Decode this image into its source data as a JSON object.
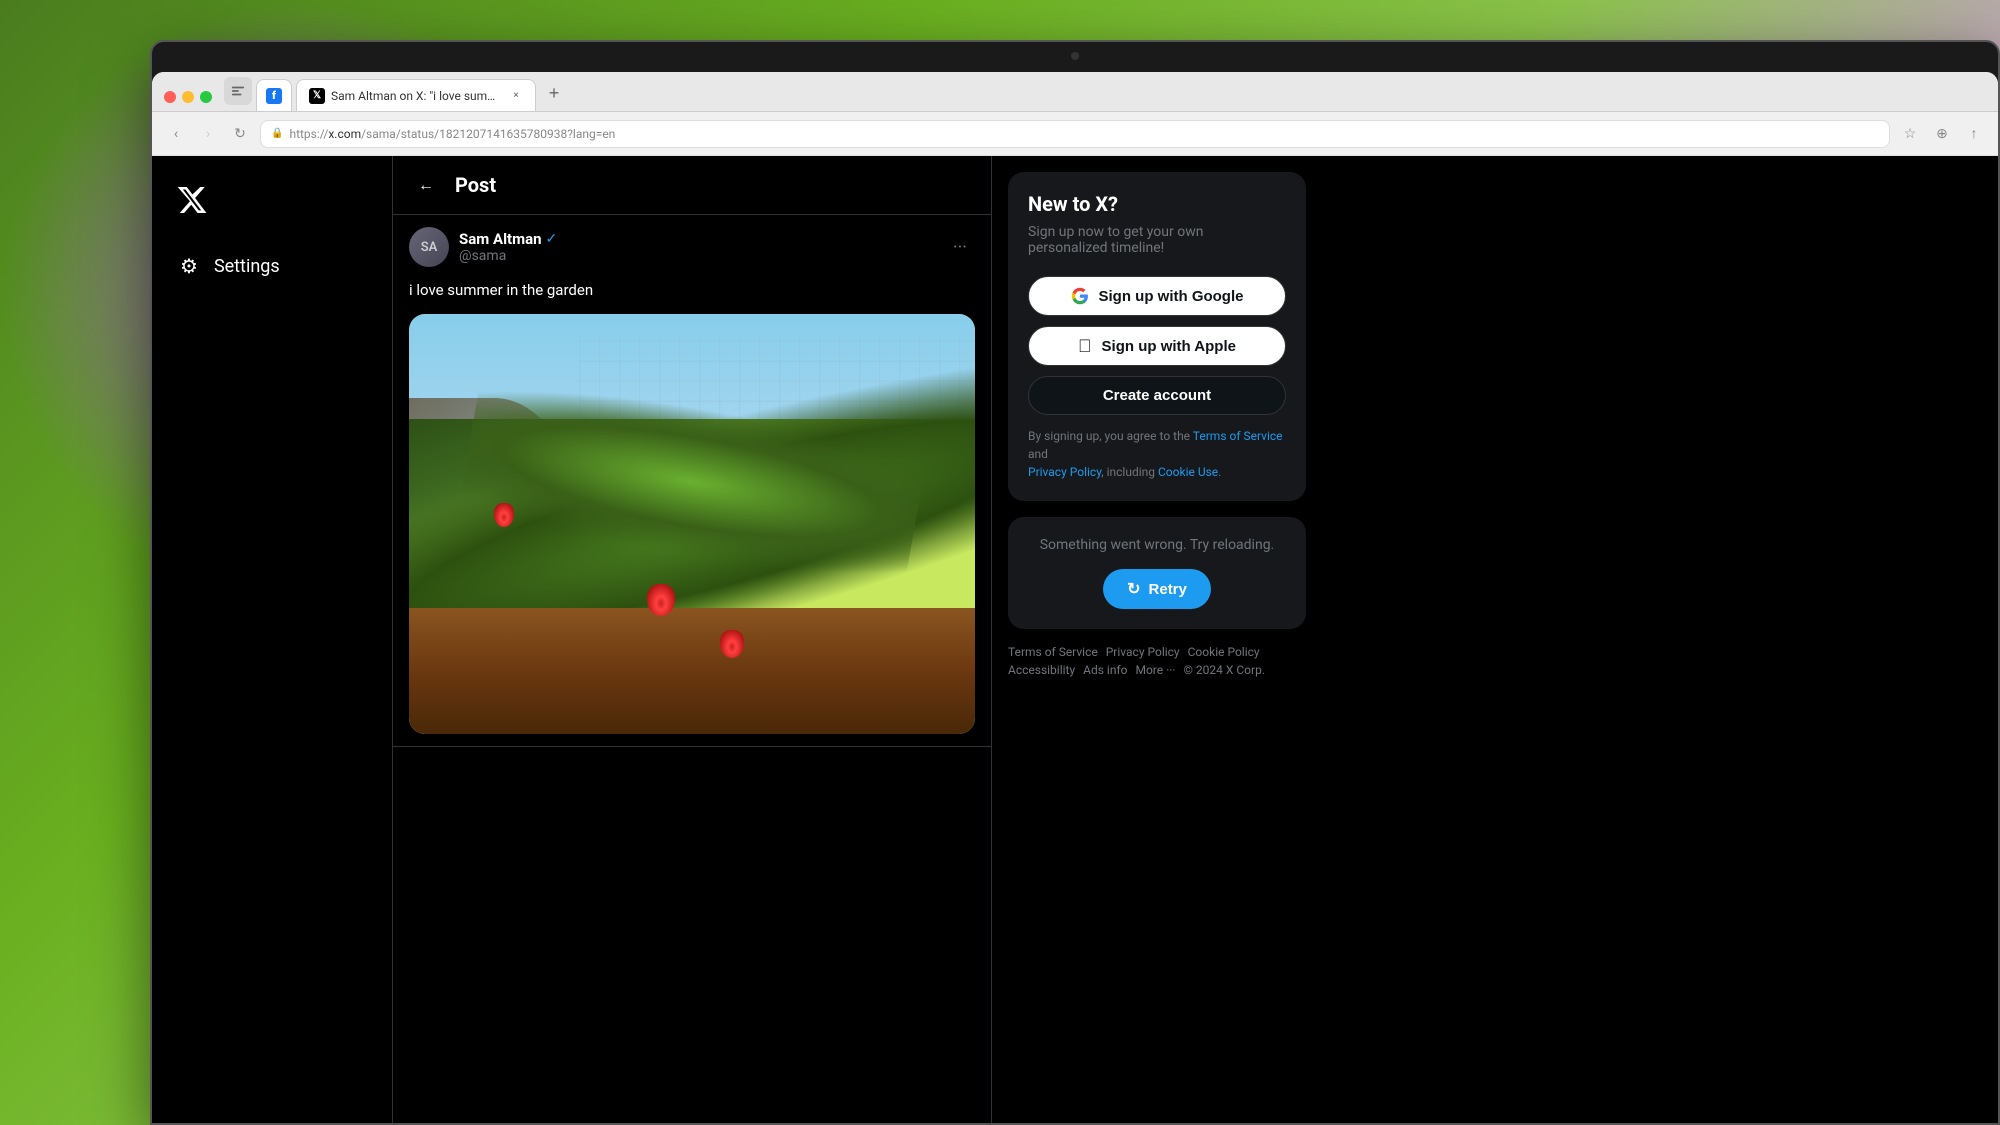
{
  "desktop": {
    "bg_colors": [
      "#4a7c1f",
      "#6ab020",
      "#8bc34a",
      "#c8a0d0",
      "#e0b0d8"
    ]
  },
  "browser": {
    "tab_pinned_label": "f",
    "tab_title": "Sam Altman on X: \"i love summ...",
    "tab_close_label": "×",
    "tab_new_label": "+",
    "nav_back_label": "‹",
    "nav_forward_label": "›",
    "nav_refresh_label": "↻",
    "url_scheme": "https://",
    "url_host": "x.com",
    "url_path": "/sama/status/1821207141635780938?lang=en",
    "url_full": "https://x.com/sama/status/1821207141635780938?lang=en",
    "bookmark_label": "☆",
    "share_label": "↑",
    "extension_label": "⊕"
  },
  "x_sidebar": {
    "logo_label": "𝕏",
    "settings_label": "Settings"
  },
  "post": {
    "header_title": "Post",
    "back_label": "←",
    "more_label": "···",
    "author_name": "Sam Altman",
    "author_verified": true,
    "author_handle": "@sama",
    "post_text": "i love summer in the garden"
  },
  "right_sidebar": {
    "new_to_x": {
      "title": "New to X?",
      "subtitle": "Sign up now to get your own personalized timeline!",
      "google_btn": "Sign up with Google",
      "apple_btn": "Sign up with Apple",
      "create_btn": "Create account",
      "tos_prefix": "By signing up, you agree to the ",
      "tos_link": "Terms of Service",
      "tos_and": " and ",
      "privacy_link": "Privacy Policy",
      "tos_suffix": ", including ",
      "cookie_link": "Cookie Use",
      "tos_end": "."
    },
    "error": {
      "message": "Something went wrong. Try reloading.",
      "retry_label": "Retry"
    },
    "footer": {
      "terms": "Terms of Service",
      "privacy": "Privacy Policy",
      "cookie": "Cookie Policy",
      "accessibility": "Accessibility",
      "ads": "Ads info",
      "more": "More ···",
      "copyright": "© 2024 X Corp."
    }
  }
}
